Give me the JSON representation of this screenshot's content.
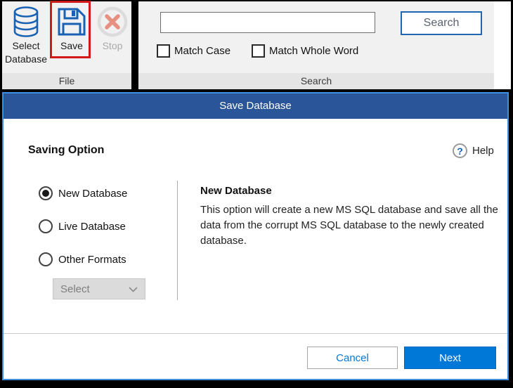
{
  "ribbon": {
    "file_group": {
      "label": "File",
      "select_database_label": "Select Database",
      "save_label": "Save",
      "stop_label": "Stop"
    },
    "search_group": {
      "label": "Search",
      "search_input_value": "",
      "search_button_label": "Search",
      "match_case_label": "Match Case",
      "match_whole_word_label": "Match Whole Word",
      "match_case_checked": false,
      "match_whole_word_checked": false
    }
  },
  "dialog": {
    "title": "Save Database",
    "heading": "Saving Option",
    "help_label": "Help",
    "help_icon_glyph": "?",
    "options": [
      {
        "label": "New Database",
        "selected": true
      },
      {
        "label": "Live Database",
        "selected": false
      },
      {
        "label": "Other Formats",
        "selected": false
      }
    ],
    "format_select": {
      "value": "Select",
      "disabled": true
    },
    "detail": {
      "heading": "New Database",
      "description": "This option will create a new MS SQL database and save all the data from the corrupt MS SQL database to the newly created database."
    },
    "footer": {
      "cancel_label": "Cancel",
      "next_label": "Next"
    }
  },
  "colors": {
    "titlebar_blue": "#2a5699",
    "dialog_border_blue": "#3c8ce0",
    "primary_button_blue": "#0078d7",
    "icon_blue": "#1961b3",
    "annotation_red": "#d01818",
    "disabled_gray": "#a9a9a9"
  }
}
